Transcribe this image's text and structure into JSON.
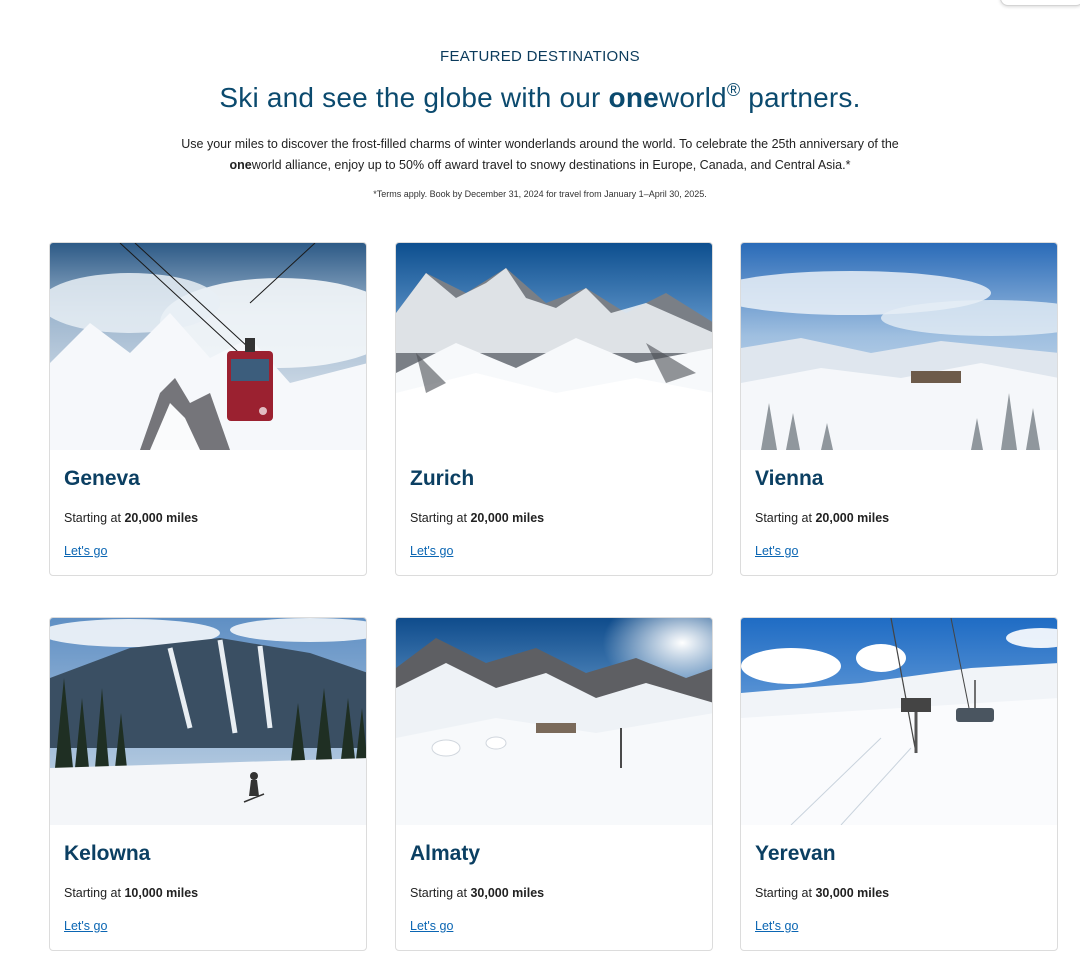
{
  "hero": {
    "eyebrow": "FEATURED DESTINATIONS",
    "headline_prefix": "Ski and see the globe with our ",
    "brand_bold": "one",
    "brand_rest": "world",
    "registered": "®",
    "headline_suffix": " partners.",
    "intro_part1": "Use your miles to discover the frost-filled charms of winter wonderlands around the world. To celebrate the 25th anniversary of the ",
    "intro_brand_bold": "one",
    "intro_part2": "world alliance, enjoy up to 50% off award travel to snowy destinations in Europe, Canada, and Central Asia.*",
    "terms": "*Terms apply. Book by December 31, 2024 for travel from January 1–April 30, 2025."
  },
  "destinations": [
    {
      "city": "Geneva",
      "price_prefix": "Starting at ",
      "miles": "20,000 miles",
      "link": "Let's go",
      "image": "gondola-snow-peaks"
    },
    {
      "city": "Zurich",
      "price_prefix": "Starting at ",
      "miles": "20,000 miles",
      "link": "Let's go",
      "image": "alpine-valley-snow"
    },
    {
      "city": "Vienna",
      "price_prefix": "Starting at ",
      "miles": "20,000 miles",
      "link": "Let's go",
      "image": "snowy-forest-ridge"
    },
    {
      "city": "Kelowna",
      "price_prefix": "Starting at ",
      "miles": "10,000 miles",
      "link": "Let's go",
      "image": "skier-mountain-runs"
    },
    {
      "city": "Almaty",
      "price_prefix": "Starting at ",
      "miles": "30,000 miles",
      "link": "Let's go",
      "image": "ski-resort-valley"
    },
    {
      "city": "Yerevan",
      "price_prefix": "Starting at ",
      "miles": "30,000 miles",
      "link": "Let's go",
      "image": "chairlift-snow-slope"
    }
  ],
  "colors": {
    "headline": "#0b4a6e",
    "city": "#0b3f62",
    "link": "#0b66b3"
  }
}
